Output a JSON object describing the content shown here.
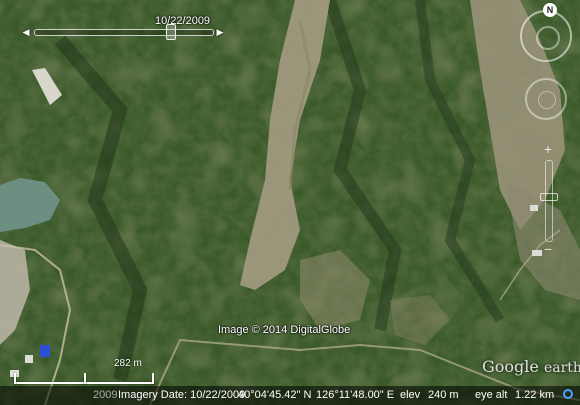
{
  "time_slider": {
    "date": "10/22/2009",
    "left_icon": "step-back-icon",
    "right_icon": "step-forward-icon"
  },
  "navigation": {
    "north": "N",
    "compass_icon": "compass-ring-icon",
    "look_icon": "look-joystick-icon",
    "zoom_in": "+",
    "zoom_out": "−"
  },
  "imagery_credit": "Image © 2014 DigitalGlobe",
  "logo": {
    "google": "Google",
    "earth": "earth"
  },
  "scale": {
    "label": "282 m"
  },
  "status_bar": {
    "imagery_year_overlay": "2009",
    "imagery_date": "Imagery Date: 10/22/2009",
    "latitude": "40°04'45.42\" N",
    "longitude": "126°11'48.00\" E",
    "elev_label": "elev",
    "elev_value": "240 m",
    "eye_alt_label": "eye alt",
    "eye_alt_value": "1.22 km",
    "streaming_icon": "streaming-indicator-icon"
  },
  "colors": {
    "forest": "#3b5a2a",
    "bare_slope": "#a59c82",
    "water": "#6c8f82",
    "status_bar": "#000000"
  }
}
